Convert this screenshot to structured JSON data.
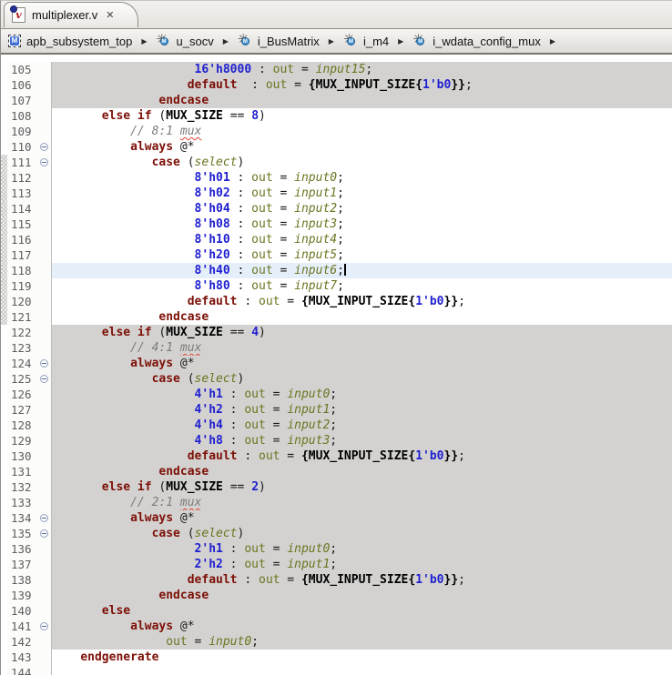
{
  "colors": {
    "keyword": "#7d1007",
    "number": "#2020d0",
    "identifier": "#6d7420",
    "comment": "#7d7d7d",
    "squiggle": "#e34234",
    "current_line_bg": "#e5effa",
    "block_highlight_bg": "#d3d2d0",
    "tab_bg": "#eae8e3",
    "breadcrumb_bg": "#e8e6e1"
  },
  "icons": {
    "close": "✕",
    "breadcrumb_arrow": "▶",
    "instance_spokes": "✳",
    "module_letter": "M",
    "instance_letter": "M",
    "file_letter": "v"
  },
  "tab": {
    "title": "multiplexer.v"
  },
  "breadcrumb": {
    "items": [
      {
        "label": "apb_subsystem_top",
        "icon": "module"
      },
      {
        "label": "u_socv",
        "icon": "instance"
      },
      {
        "label": "i_BusMatrix",
        "icon": "instance"
      },
      {
        "label": "i_m4",
        "icon": "instance"
      },
      {
        "label": "i_wdata_config_mux",
        "icon": "instance"
      }
    ]
  },
  "editor": {
    "current_line": 118,
    "gray_blocks": [
      [
        105,
        107
      ],
      [
        122,
        142
      ]
    ],
    "changed_lines": [
      [
        111,
        121
      ]
    ],
    "fold_lines": [
      110,
      111,
      124,
      125,
      134,
      135,
      141
    ],
    "lines": [
      {
        "num": 105,
        "seg": [
          [
            "t",
            "                    "
          ],
          [
            "n",
            "16'h8000"
          ],
          [
            "t",
            " : "
          ],
          [
            "o",
            "out"
          ],
          [
            "t",
            " = "
          ],
          [
            "i",
            "input15"
          ],
          [
            "t",
            ";"
          ]
        ]
      },
      {
        "num": 106,
        "seg": [
          [
            "t",
            "                   "
          ],
          [
            "k",
            "default"
          ],
          [
            "t",
            "  : "
          ],
          [
            "o",
            "out"
          ],
          [
            "t",
            " = "
          ],
          [
            "b",
            "{MUX_INPUT_SIZE{"
          ],
          [
            "n",
            "1'b0"
          ],
          [
            "b",
            "}}"
          ],
          [
            "t",
            ";"
          ]
        ]
      },
      {
        "num": 107,
        "seg": [
          [
            "t",
            "               "
          ],
          [
            "k",
            "endcase"
          ]
        ]
      },
      {
        "num": 108,
        "seg": [
          [
            "t",
            "       "
          ],
          [
            "k",
            "else if"
          ],
          [
            "t",
            " ("
          ],
          [
            "b",
            "MUX_SIZE"
          ],
          [
            "t",
            " == "
          ],
          [
            "n",
            "8"
          ],
          [
            "t",
            ")"
          ]
        ]
      },
      {
        "num": 109,
        "seg": [
          [
            "t",
            "           "
          ],
          [
            "c",
            "// 8:1 "
          ],
          [
            "w",
            "mux"
          ]
        ]
      },
      {
        "num": 110,
        "seg": [
          [
            "t",
            "           "
          ],
          [
            "k",
            "always"
          ],
          [
            "t",
            " @*"
          ]
        ]
      },
      {
        "num": 111,
        "seg": [
          [
            "t",
            "              "
          ],
          [
            "k",
            "case"
          ],
          [
            "t",
            " ("
          ],
          [
            "i",
            "select"
          ],
          [
            "t",
            ")"
          ]
        ]
      },
      {
        "num": 112,
        "seg": [
          [
            "t",
            "                    "
          ],
          [
            "n",
            "8'h01"
          ],
          [
            "t",
            " : "
          ],
          [
            "o",
            "out"
          ],
          [
            "t",
            " = "
          ],
          [
            "i",
            "input0"
          ],
          [
            "t",
            ";"
          ]
        ]
      },
      {
        "num": 113,
        "seg": [
          [
            "t",
            "                    "
          ],
          [
            "n",
            "8'h02"
          ],
          [
            "t",
            " : "
          ],
          [
            "o",
            "out"
          ],
          [
            "t",
            " = "
          ],
          [
            "i",
            "input1"
          ],
          [
            "t",
            ";"
          ]
        ]
      },
      {
        "num": 114,
        "seg": [
          [
            "t",
            "                    "
          ],
          [
            "n",
            "8'h04"
          ],
          [
            "t",
            " : "
          ],
          [
            "o",
            "out"
          ],
          [
            "t",
            " = "
          ],
          [
            "i",
            "input2"
          ],
          [
            "t",
            ";"
          ]
        ]
      },
      {
        "num": 115,
        "seg": [
          [
            "t",
            "                    "
          ],
          [
            "n",
            "8'h08"
          ],
          [
            "t",
            " : "
          ],
          [
            "o",
            "out"
          ],
          [
            "t",
            " = "
          ],
          [
            "i",
            "input3"
          ],
          [
            "t",
            ";"
          ]
        ]
      },
      {
        "num": 116,
        "seg": [
          [
            "t",
            "                    "
          ],
          [
            "n",
            "8'h10"
          ],
          [
            "t",
            " : "
          ],
          [
            "o",
            "out"
          ],
          [
            "t",
            " = "
          ],
          [
            "i",
            "input4"
          ],
          [
            "t",
            ";"
          ]
        ]
      },
      {
        "num": 117,
        "seg": [
          [
            "t",
            "                    "
          ],
          [
            "n",
            "8'h20"
          ],
          [
            "t",
            " : "
          ],
          [
            "o",
            "out"
          ],
          [
            "t",
            " = "
          ],
          [
            "i",
            "input5"
          ],
          [
            "t",
            ";"
          ]
        ]
      },
      {
        "num": 118,
        "seg": [
          [
            "t",
            "                    "
          ],
          [
            "n",
            "8'h40"
          ],
          [
            "t",
            " : "
          ],
          [
            "o",
            "out"
          ],
          [
            "t",
            " = "
          ],
          [
            "i",
            "input6"
          ],
          [
            "t",
            ";"
          ],
          [
            "caret",
            ""
          ]
        ]
      },
      {
        "num": 119,
        "seg": [
          [
            "t",
            "                    "
          ],
          [
            "n",
            "8'h80"
          ],
          [
            "t",
            " : "
          ],
          [
            "o",
            "out"
          ],
          [
            "t",
            " = "
          ],
          [
            "i",
            "input7"
          ],
          [
            "t",
            ";"
          ]
        ]
      },
      {
        "num": 120,
        "seg": [
          [
            "t",
            "                   "
          ],
          [
            "k",
            "default"
          ],
          [
            "t",
            " : "
          ],
          [
            "o",
            "out"
          ],
          [
            "t",
            " = "
          ],
          [
            "b",
            "{MUX_INPUT_SIZE{"
          ],
          [
            "n",
            "1'b0"
          ],
          [
            "b",
            "}}"
          ],
          [
            "t",
            ";"
          ]
        ]
      },
      {
        "num": 121,
        "seg": [
          [
            "t",
            "               "
          ],
          [
            "k",
            "endcase"
          ]
        ]
      },
      {
        "num": 122,
        "seg": [
          [
            "t",
            "       "
          ],
          [
            "k",
            "else if"
          ],
          [
            "t",
            " ("
          ],
          [
            "b",
            "MUX_SIZE"
          ],
          [
            "t",
            " == "
          ],
          [
            "n",
            "4"
          ],
          [
            "t",
            ")"
          ]
        ]
      },
      {
        "num": 123,
        "seg": [
          [
            "t",
            "           "
          ],
          [
            "c",
            "// 4:1 "
          ],
          [
            "w",
            "mux"
          ]
        ]
      },
      {
        "num": 124,
        "seg": [
          [
            "t",
            "           "
          ],
          [
            "k",
            "always"
          ],
          [
            "t",
            " @*"
          ]
        ]
      },
      {
        "num": 125,
        "seg": [
          [
            "t",
            "              "
          ],
          [
            "k",
            "case"
          ],
          [
            "t",
            " ("
          ],
          [
            "i",
            "select"
          ],
          [
            "t",
            ")"
          ]
        ]
      },
      {
        "num": 126,
        "seg": [
          [
            "t",
            "                    "
          ],
          [
            "n",
            "4'h1"
          ],
          [
            "t",
            " : "
          ],
          [
            "o",
            "out"
          ],
          [
            "t",
            " = "
          ],
          [
            "i",
            "input0"
          ],
          [
            "t",
            ";"
          ]
        ]
      },
      {
        "num": 127,
        "seg": [
          [
            "t",
            "                    "
          ],
          [
            "n",
            "4'h2"
          ],
          [
            "t",
            " : "
          ],
          [
            "o",
            "out"
          ],
          [
            "t",
            " = "
          ],
          [
            "i",
            "input1"
          ],
          [
            "t",
            ";"
          ]
        ]
      },
      {
        "num": 128,
        "seg": [
          [
            "t",
            "                    "
          ],
          [
            "n",
            "4'h4"
          ],
          [
            "t",
            " : "
          ],
          [
            "o",
            "out"
          ],
          [
            "t",
            " = "
          ],
          [
            "i",
            "input2"
          ],
          [
            "t",
            ";"
          ]
        ]
      },
      {
        "num": 129,
        "seg": [
          [
            "t",
            "                    "
          ],
          [
            "n",
            "4'h8"
          ],
          [
            "t",
            " : "
          ],
          [
            "o",
            "out"
          ],
          [
            "t",
            " = "
          ],
          [
            "i",
            "input3"
          ],
          [
            "t",
            ";"
          ]
        ]
      },
      {
        "num": 130,
        "seg": [
          [
            "t",
            "                   "
          ],
          [
            "k",
            "default"
          ],
          [
            "t",
            " : "
          ],
          [
            "o",
            "out"
          ],
          [
            "t",
            " = "
          ],
          [
            "b",
            "{MUX_INPUT_SIZE{"
          ],
          [
            "n",
            "1'b0"
          ],
          [
            "b",
            "}}"
          ],
          [
            "t",
            ";"
          ]
        ]
      },
      {
        "num": 131,
        "seg": [
          [
            "t",
            "               "
          ],
          [
            "k",
            "endcase"
          ]
        ]
      },
      {
        "num": 132,
        "seg": [
          [
            "t",
            "       "
          ],
          [
            "k",
            "else if"
          ],
          [
            "t",
            " ("
          ],
          [
            "b",
            "MUX_SIZE"
          ],
          [
            "t",
            " == "
          ],
          [
            "n",
            "2"
          ],
          [
            "t",
            ")"
          ]
        ]
      },
      {
        "num": 133,
        "seg": [
          [
            "t",
            "           "
          ],
          [
            "c",
            "// 2:1 "
          ],
          [
            "w",
            "mux"
          ]
        ]
      },
      {
        "num": 134,
        "seg": [
          [
            "t",
            "           "
          ],
          [
            "k",
            "always"
          ],
          [
            "t",
            " @*"
          ]
        ]
      },
      {
        "num": 135,
        "seg": [
          [
            "t",
            "              "
          ],
          [
            "k",
            "case"
          ],
          [
            "t",
            " ("
          ],
          [
            "i",
            "select"
          ],
          [
            "t",
            ")"
          ]
        ]
      },
      {
        "num": 136,
        "seg": [
          [
            "t",
            "                    "
          ],
          [
            "n",
            "2'h1"
          ],
          [
            "t",
            " : "
          ],
          [
            "o",
            "out"
          ],
          [
            "t",
            " = "
          ],
          [
            "i",
            "input0"
          ],
          [
            "t",
            ";"
          ]
        ]
      },
      {
        "num": 137,
        "seg": [
          [
            "t",
            "                    "
          ],
          [
            "n",
            "2'h2"
          ],
          [
            "t",
            " : "
          ],
          [
            "o",
            "out"
          ],
          [
            "t",
            " = "
          ],
          [
            "i",
            "input1"
          ],
          [
            "t",
            ";"
          ]
        ]
      },
      {
        "num": 138,
        "seg": [
          [
            "t",
            "                   "
          ],
          [
            "k",
            "default"
          ],
          [
            "t",
            " : "
          ],
          [
            "o",
            "out"
          ],
          [
            "t",
            " = "
          ],
          [
            "b",
            "{MUX_INPUT_SIZE{"
          ],
          [
            "n",
            "1'b0"
          ],
          [
            "b",
            "}}"
          ],
          [
            "t",
            ";"
          ]
        ]
      },
      {
        "num": 139,
        "seg": [
          [
            "t",
            "               "
          ],
          [
            "k",
            "endcase"
          ]
        ]
      },
      {
        "num": 140,
        "seg": [
          [
            "t",
            "       "
          ],
          [
            "k",
            "else"
          ]
        ]
      },
      {
        "num": 141,
        "seg": [
          [
            "t",
            "           "
          ],
          [
            "k",
            "always"
          ],
          [
            "t",
            " @*"
          ]
        ]
      },
      {
        "num": 142,
        "seg": [
          [
            "t",
            "                "
          ],
          [
            "o",
            "out"
          ],
          [
            "t",
            " = "
          ],
          [
            "i",
            "input0"
          ],
          [
            "t",
            ";"
          ]
        ]
      },
      {
        "num": 143,
        "seg": [
          [
            "t",
            "    "
          ],
          [
            "k",
            "endgenerate"
          ]
        ]
      },
      {
        "num": 144,
        "seg": []
      }
    ]
  }
}
